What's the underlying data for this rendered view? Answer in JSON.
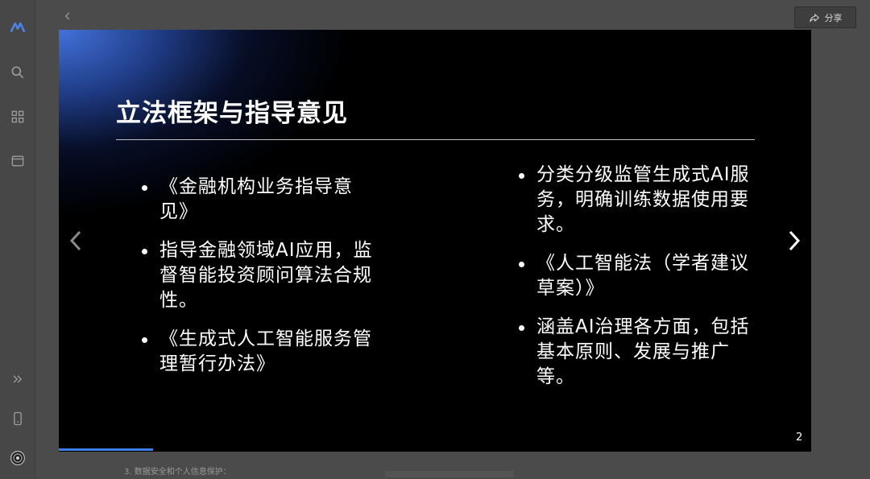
{
  "toolbar": {
    "share_label": "分享"
  },
  "slide": {
    "title": "立法框架与指导意见",
    "left_bullets": [
      "《金融机构业务指导意见》",
      "指导金融领域AI应用，监督智能投资顾问算法合规性。",
      "《生成式人工智能服务管理暂行办法》"
    ],
    "right_bullets": [
      "分类分级监管生成式AI服务，明确训练数据使用要求。",
      "《人工智能法（学者建议草案）》",
      "涵盖AI治理各方面，包括基本原则、发展与推广等。"
    ],
    "page_number": "2",
    "progress": 0.125
  },
  "document": {
    "next_heading": "3. 数据安全和个人信息保护："
  },
  "colors": {
    "accent": "#3d7ff0",
    "slide_bg": "#000000",
    "app_bg": "#4b4b4b"
  },
  "icons": {
    "logo": "app-logo-icon",
    "search": "search-icon",
    "apps": "grid-icon",
    "window": "window-icon",
    "expand": "double-chevron-right-icon",
    "phone": "mobile-icon",
    "avatar": "avatar-icon",
    "share": "share-arrow-icon",
    "back": "chevron-left-icon",
    "prev": "chevron-left-icon",
    "next": "chevron-right-icon"
  }
}
